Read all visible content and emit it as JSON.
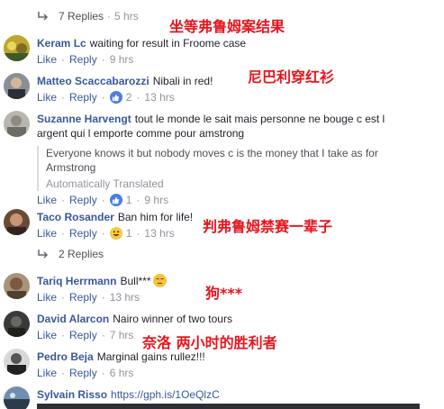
{
  "top_replies": {
    "count": "7 Replies",
    "time": "5 hrs"
  },
  "comments": [
    {
      "name": "Keram Lc",
      "text": "waiting for result in Froome case",
      "like": "Like",
      "reply": "Reply",
      "time": "9 hrs"
    },
    {
      "name": "Matteo Scaccabarozzi",
      "text": "Nibali in red!",
      "like": "Like",
      "reply": "Reply",
      "reactions": "2",
      "time": "13 hrs"
    },
    {
      "name": "Suzanne Harvengt",
      "text": "tout le monde le sait mais personne ne bouge c est l argent qui l emporte comme pour amstrong",
      "translation": "Everyone knows it but nobody moves c is the money that I take as for Armstrong",
      "translated_tag": "Automatically Translated",
      "like": "Like",
      "reply": "Reply",
      "reactions": "1",
      "time": "9 hrs"
    },
    {
      "name": "Taco Rosander",
      "text": "Ban him for life!",
      "like": "Like",
      "reply": "Reply",
      "reactions": "1",
      "time": "13 hrs"
    },
    {
      "name": "Tariq Herrmann",
      "text": "Bull***",
      "like": "Like",
      "reply": "Reply",
      "time": "13 hrs"
    },
    {
      "name": "David Alarcon",
      "text": "Nairo winner of two tours",
      "like": "Like",
      "reply": "Reply",
      "time": "7 hrs"
    },
    {
      "name": "Pedro Beja",
      "text": "Marginal gains rullez!!!",
      "like": "Like",
      "reply": "Reply",
      "time": "6 hrs"
    },
    {
      "name": "Sylvain Risso",
      "text": "https://gph.is/1OeQlzC"
    }
  ],
  "sub_replies": {
    "count": "2 Replies"
  },
  "annotations": {
    "a1": "坐等弗鲁姆案结果",
    "a2": "尼巴利穿红衫",
    "a3": "判弗鲁姆禁赛一辈子",
    "a4": "狗***",
    "a5": "奈洛 两小时的胜利者"
  },
  "colors": {
    "link": "#385898",
    "meta": "#90949c",
    "annotation": "#e8141c",
    "like_badge": "#4a7fe0",
    "haha_badge": "#f7c844"
  }
}
